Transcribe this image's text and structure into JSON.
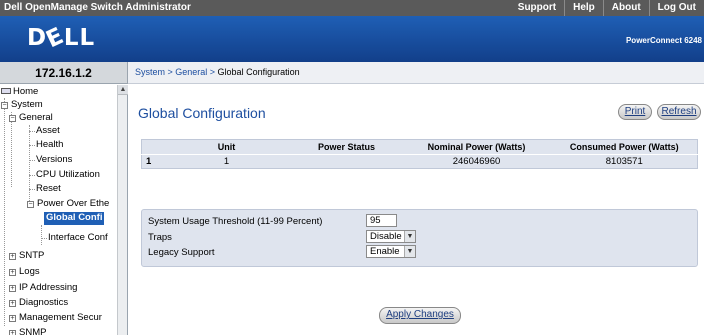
{
  "app": {
    "title": "Dell OpenManage Switch Administrator",
    "logo": "DELL",
    "model": "PowerConnect 6248"
  },
  "topmenu": [
    "Support",
    "Help",
    "About",
    "Log Out"
  ],
  "address": "172.16.1.2",
  "breadcrumb": {
    "path": "System > General > ",
    "current": "Global Configuration"
  },
  "tree": {
    "home": "Home",
    "system": "System",
    "general": "General",
    "asset": "Asset",
    "health": "Health",
    "versions": "Versions",
    "cpu": "CPU Utilization",
    "reset": "Reset",
    "poe": "Power Over Ethe",
    "global": "Global Confi",
    "interface": "Interface Conf",
    "sntp": "SNTP",
    "logs": "Logs",
    "ip": "IP Addressing",
    "diag": "Diagnostics",
    "mgmt": "Management Secur",
    "snmp": "SNMP"
  },
  "page": {
    "title": "Global Configuration",
    "print_label": "Print",
    "refresh_label": "Refresh"
  },
  "power_table": {
    "headers": [
      "Unit",
      "Power Status",
      "Nominal Power (Watts)",
      "Consumed Power (Watts)"
    ],
    "rows": [
      {
        "index": "1",
        "unit": "1",
        "status": "",
        "nominal": "246046960",
        "consumed": "8103571"
      }
    ]
  },
  "form": {
    "threshold_label": "System Usage Threshold (11-99 Percent)",
    "threshold_value": "95",
    "traps_label": "Traps",
    "traps_value": "Disable",
    "legacy_label": "Legacy Support",
    "legacy_value": "Enable"
  },
  "apply_label": "Apply Changes",
  "colors": {
    "brand": "#1f5fb5",
    "link": "#1e4fa0",
    "panel": "#dfe4ee"
  }
}
